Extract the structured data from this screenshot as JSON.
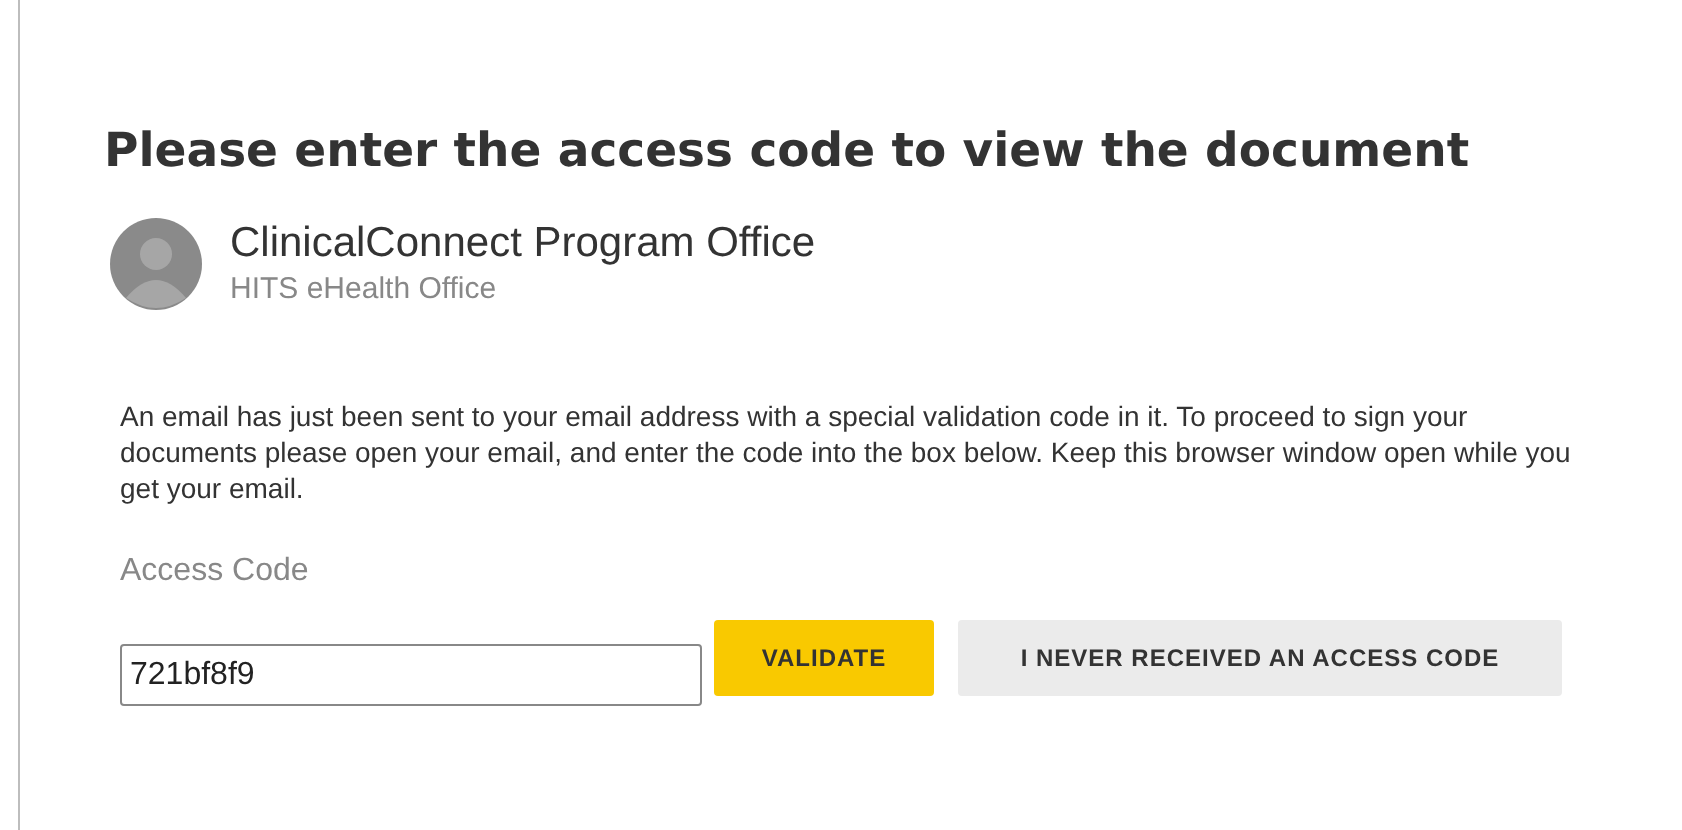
{
  "title": "Please enter the access code to view the document",
  "sender": {
    "name": "ClinicalConnect Program Office",
    "organization": "HITS eHealth Office"
  },
  "message": "An email has just been sent to your email address with a special validation code in it. To proceed to sign your documents please open your email, and enter the code into the box below. Keep this browser window open while you get your email.",
  "access_code": {
    "label": "Access Code",
    "value": "721bf8f9"
  },
  "buttons": [
    {
      "label": "VALIDATE",
      "kind": "primary"
    },
    {
      "label": "I NEVER RECEIVED AN ACCESS CODE",
      "kind": "secondary"
    }
  ]
}
